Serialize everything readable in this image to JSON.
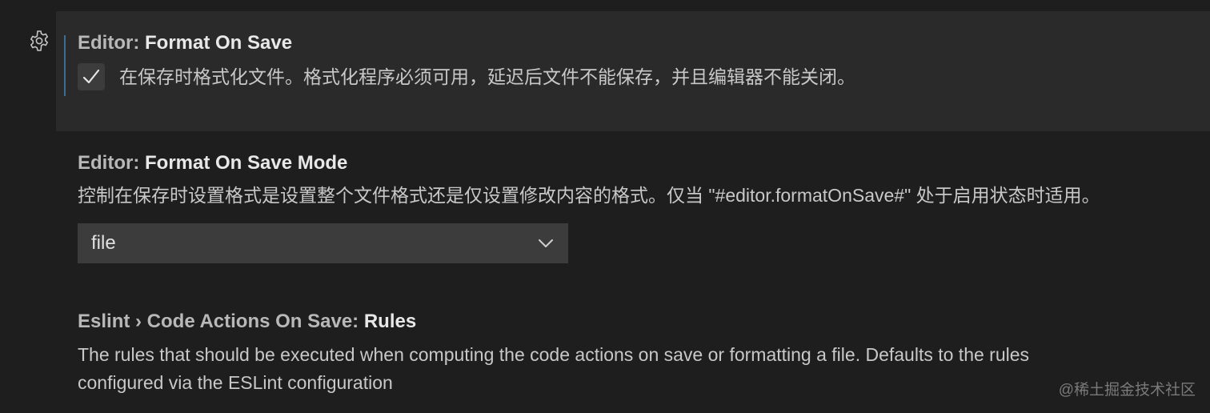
{
  "settings": [
    {
      "category": "Editor: ",
      "name": "Format On Save",
      "checked": true,
      "description": "在保存时格式化文件。格式化程序必须可用，延迟后文件不能保存，并且编辑器不能关闭。"
    },
    {
      "category": "Editor: ",
      "name": "Format On Save Mode",
      "description": "控制在保存时设置格式是设置整个文件格式还是仅设置修改内容的格式。仅当 \"#editor.formatOnSave#\" 处于启用状态时适用。",
      "dropdown_value": "file"
    },
    {
      "category": "Eslint › Code Actions On Save: ",
      "name": "Rules",
      "description_line1": "The rules that should be executed when computing the code actions on save or formatting a file. Defaults to the rules",
      "description_line2": "configured via the ESLint configuration"
    }
  ],
  "watermark": "@稀土掘金技术社区",
  "colors": {
    "background": "#1e1e1e",
    "focused_row": "#2a2a2a",
    "focus_indicator": "#3b6e94",
    "input_background": "#3c3c3c"
  },
  "icons": {
    "gear": "gear-icon",
    "check": "check-icon",
    "chevron": "chevron-down-icon"
  }
}
